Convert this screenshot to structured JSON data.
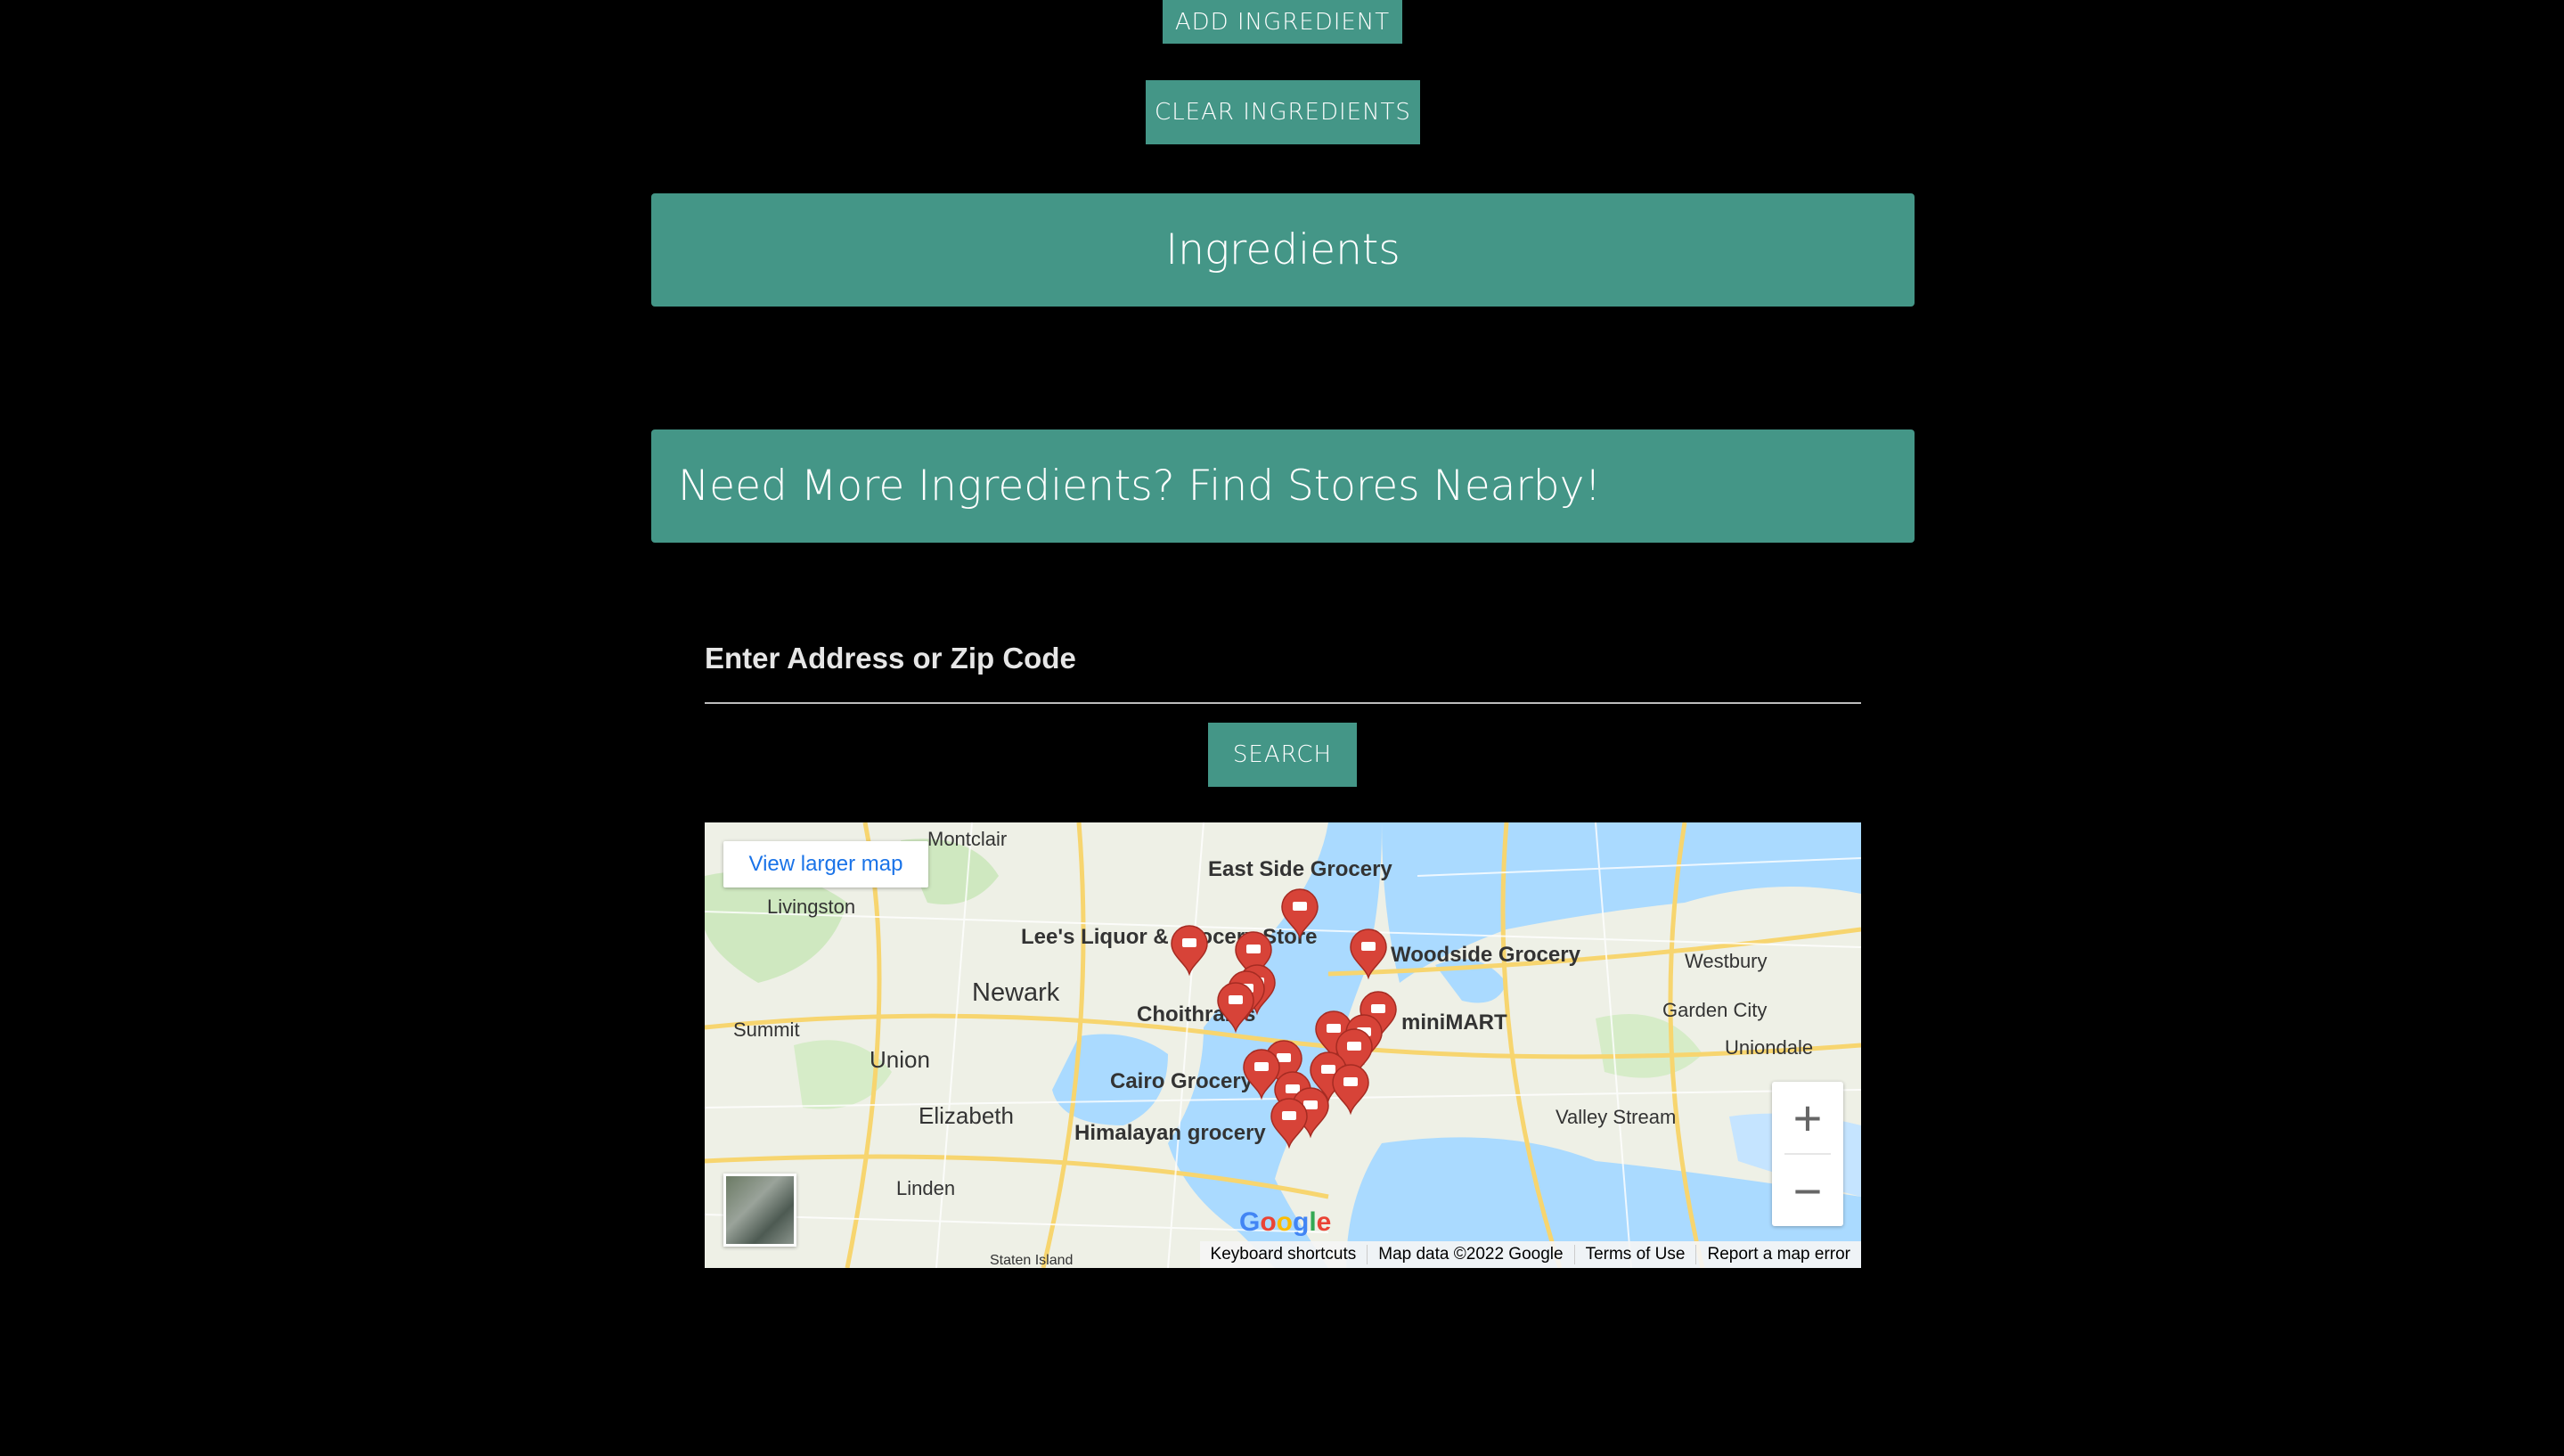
{
  "buttons": {
    "add_ingredient": "ADD INGREDIENT",
    "clear_ingredients": "CLEAR INGREDIENTS",
    "search": "SEARCH"
  },
  "panels": {
    "ingredients_title": "Ingredients",
    "stores_title": "Need More Ingredients? Find Stores Nearby!"
  },
  "search": {
    "label": "Enter Address or Zip Code"
  },
  "map": {
    "view_larger": "View larger map",
    "zoom_in": "+",
    "zoom_out": "−",
    "logo": "Google",
    "footer": {
      "shortcuts": "Keyboard shortcuts",
      "data": "Map data ©2022 Google",
      "terms": "Terms of Use",
      "report": "Report a map error"
    },
    "places": [
      "Montclair",
      "Livingston",
      "Newark",
      "Summit",
      "Union",
      "Elizabeth",
      "Linden",
      "Westbury",
      "Garden City",
      "Uniondale",
      "Valley Stream",
      "Staten Island"
    ],
    "stores": [
      "East Side Grocery",
      "Lee's Liquor & Grocery Store",
      "Woodside Grocery",
      "Choithrams",
      "miniMART",
      "Cairo Grocery",
      "Himalayan grocery"
    ],
    "colors": {
      "water": "#aadaff",
      "land": "#f2efe9",
      "marker": "#d74338",
      "accent": "#449687"
    }
  }
}
